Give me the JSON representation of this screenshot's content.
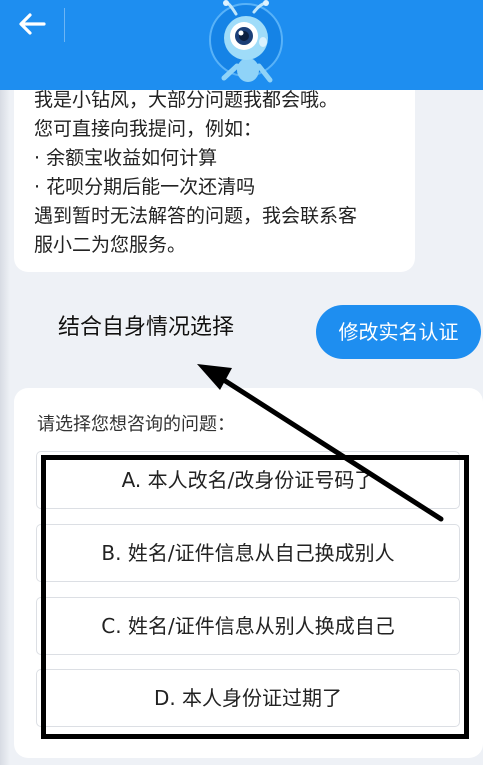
{
  "header": {
    "back_icon": "arrow-left-icon",
    "avatar_icon": "ant-mascot-icon",
    "accent_color": "#1e8ef0"
  },
  "intro": {
    "lines": [
      "我是小钻风，大部分问题我都会哦。",
      "您可直接向我提问，例如：",
      "· 余额宝收益如何计算",
      "· 花呗分期后能一次还清吗",
      "遇到暂时无法解答的问题，我会联系客",
      "服小二为您服务。"
    ]
  },
  "annotation": {
    "text": "结合自身情况选择"
  },
  "user_message": {
    "text": "修改实名认证"
  },
  "options": {
    "prompt": "请选择您想咨询的问题：",
    "items": [
      "A. 本人改名/改身份证号码了",
      "B. 姓名/证件信息从自己换成别人",
      "C. 姓名/证件信息从别人换成自己",
      "D. 本人身份证过期了"
    ]
  }
}
